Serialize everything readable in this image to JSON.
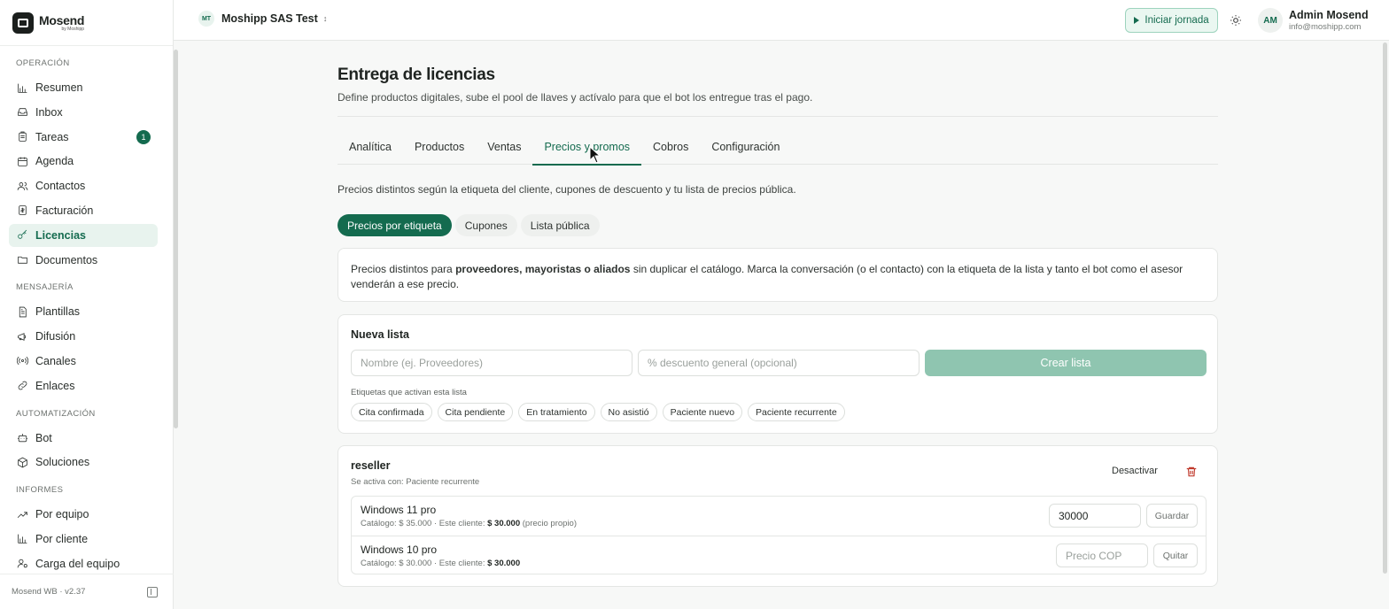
{
  "brand": {
    "name": "Mosend",
    "sub": "by Moshipp"
  },
  "sidebar": {
    "sections": [
      {
        "label": "OPERACIÓN",
        "items": [
          {
            "label": "Resumen",
            "icon": "bar-chart-icon"
          },
          {
            "label": "Inbox",
            "icon": "inbox-icon"
          },
          {
            "label": "Tareas",
            "icon": "clipboard-icon",
            "badge": "1"
          },
          {
            "label": "Agenda",
            "icon": "calendar-icon"
          },
          {
            "label": "Contactos",
            "icon": "users-icon"
          },
          {
            "label": "Facturación",
            "icon": "receipt-icon"
          },
          {
            "label": "Licencias",
            "icon": "key-icon",
            "active": true
          },
          {
            "label": "Documentos",
            "icon": "folder-icon"
          }
        ]
      },
      {
        "label": "MENSAJERÍA",
        "items": [
          {
            "label": "Plantillas",
            "icon": "file-text-icon"
          },
          {
            "label": "Difusión",
            "icon": "megaphone-icon"
          },
          {
            "label": "Canales",
            "icon": "radio-icon"
          },
          {
            "label": "Enlaces",
            "icon": "link-icon"
          }
        ]
      },
      {
        "label": "AUTOMATIZACIÓN",
        "items": [
          {
            "label": "Bot",
            "icon": "bot-icon"
          },
          {
            "label": "Soluciones",
            "icon": "package-icon"
          }
        ]
      },
      {
        "label": "INFORMES",
        "items": [
          {
            "label": "Por equipo",
            "icon": "trending-up-icon"
          },
          {
            "label": "Por cliente",
            "icon": "bar-chart-icon"
          },
          {
            "label": "Carga del equipo",
            "icon": "user-cog-icon"
          }
        ]
      }
    ],
    "footer": "Mosend WB · v2.37"
  },
  "topbar": {
    "org_initials": "MT",
    "org_name": "Moshipp SAS Test",
    "start_label": "Iniciar jornada",
    "user_initials": "AM",
    "user_name": "Admin Mosend",
    "user_email": "info@moshipp.com"
  },
  "page": {
    "title": "Entrega de licencias",
    "subtitle": "Define productos digitales, sube el pool de llaves y actívalo para que el bot los entregue tras el pago.",
    "tabs": [
      "Analítica",
      "Productos",
      "Ventas",
      "Precios y promos",
      "Cobros",
      "Configuración"
    ],
    "active_tab": 3,
    "tabs_desc": "Precios distintos según la etiqueta del cliente, cupones de descuento y tu lista de precios pública.",
    "pills": [
      "Precios por etiqueta",
      "Cupones",
      "Lista pública"
    ],
    "info": {
      "pre": "Precios distintos para ",
      "bold": "proveedores, mayoristas o aliados",
      "post": " sin duplicar el catálogo. Marca la conversación (o el contacto) con la etiqueta de la lista y tanto el bot como el asesor venderán a ese precio."
    },
    "new_list": {
      "title": "Nueva lista",
      "name_placeholder": "Nombre (ej. Proveedores)",
      "discount_placeholder": "% descuento general (opcional)",
      "create_label": "Crear lista",
      "tags_label": "Etiquetas que activan esta lista",
      "tags": [
        "Cita confirmada",
        "Cita pendiente",
        "En tratamiento",
        "No asistió",
        "Paciente nuevo",
        "Paciente recurrente"
      ]
    },
    "list": {
      "name": "reseller",
      "active_with": "Se activa con: Paciente recurrente",
      "deactivate_label": "Desactivar",
      "products": [
        {
          "name": "Windows 11 pro",
          "catalog": "Catálogo: $ 35.000 · Este cliente: ",
          "client_price": "$ 30.000",
          "note": " (precio propio)",
          "value": "30000",
          "placeholder": "",
          "action": "Guardar"
        },
        {
          "name": "Windows 10 pro",
          "catalog": "Catálogo: $ 30.000 · Este cliente: ",
          "client_price": "$ 30.000",
          "note": "",
          "value": "",
          "placeholder": "Precio COP",
          "action": "Quitar"
        }
      ]
    }
  },
  "colors": {
    "accent": "#146b4f",
    "accent_light": "#e8f3ee",
    "danger": "#c0392b"
  }
}
